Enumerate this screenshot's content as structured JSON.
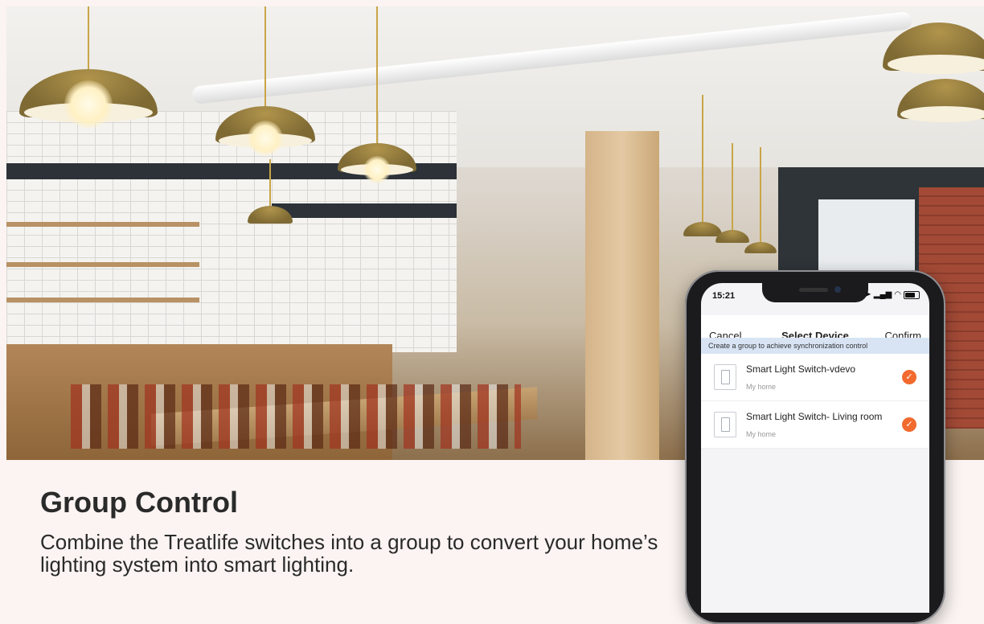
{
  "marketing": {
    "headline": "Group Control",
    "description": "Combine the Treatlife switches into a group to convert your home’s lighting system into smart lighting."
  },
  "phone": {
    "status_time": "15:21",
    "status_icons": [
      "location-arrow-icon",
      "signal-icon",
      "wifi-icon",
      "battery-icon"
    ],
    "nav": {
      "cancel_label": "Cancel",
      "title": "Select Device",
      "confirm_label": "Confirm"
    },
    "hint": "Create a group to achieve synchronization control",
    "devices": [
      {
        "name": "Smart Light Switch-vdevo",
        "location": "My home",
        "selected": true
      },
      {
        "name": "Smart Light Switch- Living room",
        "location": "My home",
        "selected": true
      }
    ]
  },
  "colors": {
    "accent": "#f26a2e",
    "hint_bg": "#d8e4f4",
    "text": "#2a2a2a",
    "page_bg": "#fbf4f2"
  }
}
